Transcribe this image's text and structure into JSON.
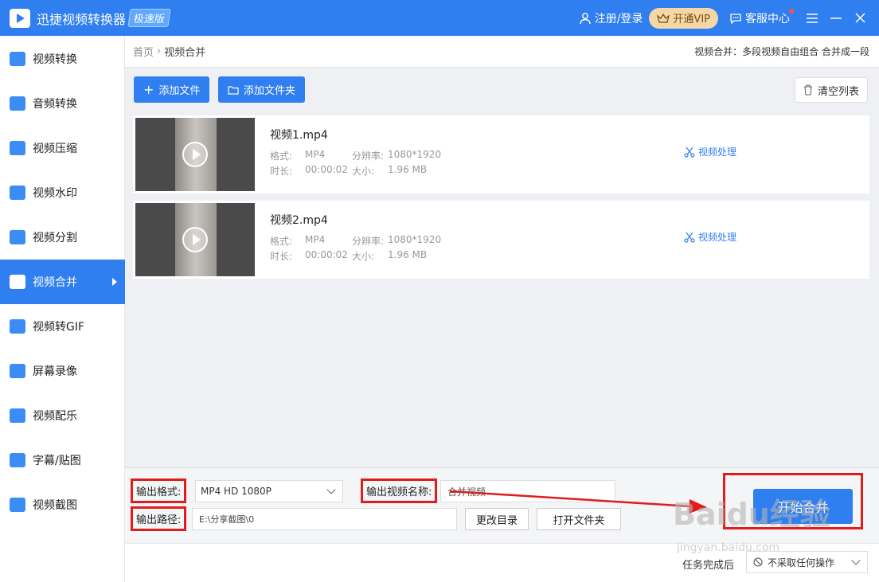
{
  "titlebar": {
    "app_name": "迅捷视频转换器",
    "edition_badge": "极速版",
    "login": "注册/登录",
    "vip": "开通VIP",
    "service": "客服中心"
  },
  "sidebar": {
    "items": [
      {
        "label": "视频转换",
        "icon": "video-convert-icon"
      },
      {
        "label": "音频转换",
        "icon": "audio-convert-icon"
      },
      {
        "label": "视频压缩",
        "icon": "video-compress-icon"
      },
      {
        "label": "视频水印",
        "icon": "video-watermark-icon"
      },
      {
        "label": "视频分割",
        "icon": "video-split-icon"
      },
      {
        "label": "视频合并",
        "icon": "video-merge-icon",
        "active": true
      },
      {
        "label": "视频转GIF",
        "icon": "gif-icon"
      },
      {
        "label": "屏幕录像",
        "icon": "screen-record-icon"
      },
      {
        "label": "视频配乐",
        "icon": "music-icon"
      },
      {
        "label": "字幕/贴图",
        "icon": "subtitle-icon"
      },
      {
        "label": "视频截图",
        "icon": "screenshot-icon"
      }
    ]
  },
  "breadcrumb": {
    "home": "首页",
    "current": "视频合并",
    "description": "视频合并：多段视频自由组合 合并成一段"
  },
  "toolbar": {
    "add_file": "添加文件",
    "add_folder": "添加文件夹",
    "clear_list": "清空列表"
  },
  "files": [
    {
      "name": "视频1.mp4",
      "format_label": "格式:",
      "format": "MP4",
      "resolution_label": "分辨率:",
      "resolution": "1080*1920",
      "duration_label": "时长:",
      "duration": "00:00:02",
      "size_label": "大小:",
      "size": "1.96 MB",
      "action": "视频处理"
    },
    {
      "name": "视频2.mp4",
      "format_label": "格式:",
      "format": "MP4",
      "resolution_label": "分辨率:",
      "resolution": "1080*1920",
      "duration_label": "时长:",
      "duration": "00:00:02",
      "size_label": "大小:",
      "size": "1.96 MB",
      "action": "视频处理"
    }
  ],
  "output": {
    "format_label": "输出格式:",
    "format_value": "MP4  HD 1080P",
    "name_label": "输出视频名称:",
    "name_value": "合并视频",
    "path_label": "输出路径:",
    "path_value": "E:\\分享截图\\0",
    "change_dir": "更改目录",
    "open_folder": "打开文件夹",
    "start": "开始合并"
  },
  "footer": {
    "after_label": "任务完成后",
    "after_value": "不采取任何操作"
  },
  "watermark": {
    "text": "Baidu经验",
    "sub": "jingyan.baidu.com"
  },
  "colors": {
    "primary": "#2f7ff0",
    "annotation": "#e01c1c",
    "vip": "#f4d7a6"
  }
}
